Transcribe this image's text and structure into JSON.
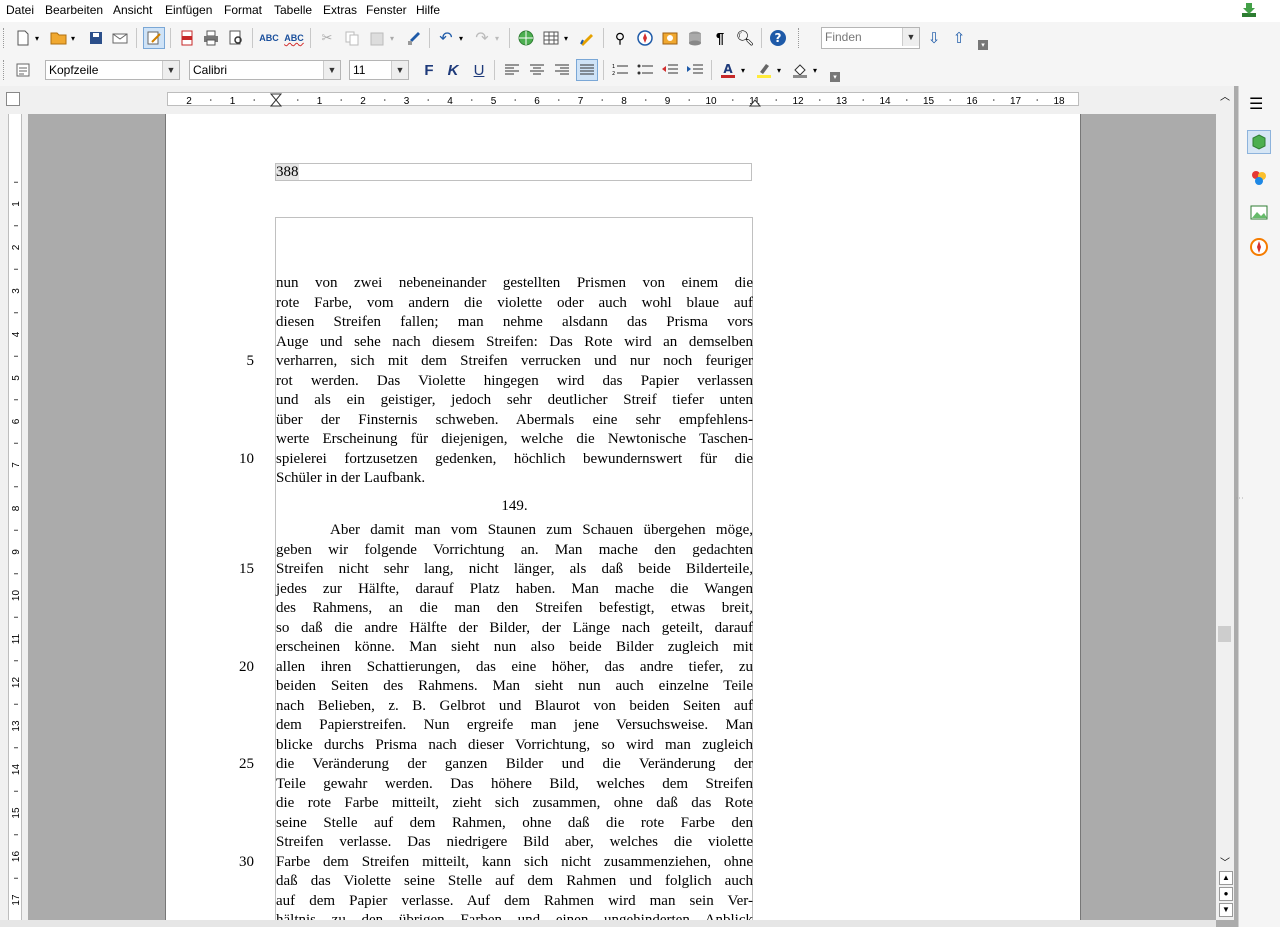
{
  "menu": {
    "items": [
      "Datei",
      "Bearbeiten",
      "Ansicht",
      "Einfügen",
      "Format",
      "Tabelle",
      "Extras",
      "Fenster",
      "Hilfe"
    ]
  },
  "find": {
    "placeholder": "Finden"
  },
  "formatting": {
    "style": "Kopfzeile",
    "font": "Calibri",
    "size": "11",
    "bold": "F",
    "italic": "K",
    "underline": "U"
  },
  "ruler": {
    "h_labels": [
      "2",
      "1",
      "1",
      "2",
      "3",
      "4",
      "5",
      "6",
      "7",
      "8",
      "9",
      "10",
      "11",
      "12",
      "13",
      "14",
      "15",
      "16",
      "17",
      "18"
    ],
    "v_labels": [
      "1",
      "2",
      "3",
      "4",
      "5",
      "6",
      "7",
      "8",
      "9",
      "10",
      "11",
      "12",
      "13",
      "14",
      "15",
      "16",
      "17"
    ]
  },
  "document": {
    "header": "388",
    "lines": [
      {
        "t": "nun von zwei nebeneinander gestellten Prismen von einem die",
        "n": ""
      },
      {
        "t": "rote Farbe, vom andern die violette oder auch wohl blaue auf",
        "n": ""
      },
      {
        "t": "diesen Streifen fallen; man nehme alsdann das Prisma vors",
        "n": ""
      },
      {
        "t": "Auge und sehe nach diesem Streifen: Das Rote wird an demselben",
        "n": ""
      },
      {
        "t": "verharren, sich mit dem Streifen verrucken und nur noch feuriger",
        "n": "5"
      },
      {
        "t": "rot werden. Das Violette hingegen wird das Papier verlassen",
        "n": ""
      },
      {
        "t": "und als ein geistiger, jedoch sehr deutlicher Streif tiefer unten",
        "n": ""
      },
      {
        "t": "über der Finsternis schweben. Abermals eine sehr empfehlens-",
        "n": ""
      },
      {
        "t": "werte Erscheinung für diejenigen, welche die Newtonische Taschen-",
        "n": ""
      },
      {
        "t": "spielerei fortzusetzen gedenken, höchlich bewundernswert für die",
        "n": "10"
      },
      {
        "t": "Schüler in der Laufbank.",
        "n": "",
        "last": true
      },
      {
        "t": "149.",
        "n": "",
        "center": true
      },
      {
        "t": "Aber damit man vom Staunen zum Schauen übergehen möge,",
        "n": "",
        "indent": true
      },
      {
        "t": "geben wir folgende Vorrichtung an. Man mache den gedachten",
        "n": ""
      },
      {
        "t": "Streifen nicht sehr lang, nicht länger, als daß beide Bilderteile,",
        "n": "15"
      },
      {
        "t": "jedes zur Hälfte, darauf Platz haben. Man mache die Wangen",
        "n": ""
      },
      {
        "t": "des Rahmens, an die man den Streifen befestigt, etwas breit,",
        "n": ""
      },
      {
        "t": "so daß die andre Hälfte der Bilder, der Länge nach geteilt, darauf",
        "n": ""
      },
      {
        "t": "erscheinen könne. Man sieht nun also beide Bilder zugleich mit",
        "n": ""
      },
      {
        "t": "allen ihren Schattierungen, das eine höher, das andre tiefer, zu",
        "n": "20"
      },
      {
        "t": "beiden Seiten des Rahmens. Man sieht nun auch einzelne Teile",
        "n": ""
      },
      {
        "t": "nach Belieben, z. B. Gelbrot und Blaurot von beiden Seiten auf",
        "n": ""
      },
      {
        "t": "dem Papierstreifen. Nun ergreife man jene Versuchsweise. Man",
        "n": ""
      },
      {
        "t": "blicke durchs Prisma nach dieser Vorrichtung, so wird man zugleich",
        "n": ""
      },
      {
        "t": "die Veränderung der ganzen Bilder und die Veränderung der",
        "n": "25"
      },
      {
        "t": "Teile gewahr werden. Das höhere Bild, welches dem Streifen",
        "n": ""
      },
      {
        "t": "die rote Farbe mitteilt, zieht sich zusammen, ohne daß das Rote",
        "n": ""
      },
      {
        "t": "seine Stelle auf dem Rahmen, ohne daß die rote Farbe den",
        "n": ""
      },
      {
        "t": "Streifen verlasse. Das niedrigere Bild aber, welches die violette",
        "n": ""
      },
      {
        "t": "Farbe dem Streifen mitteilt, kann sich nicht zusammenziehen, ohne",
        "n": "30"
      },
      {
        "t": "daß das Violette seine Stelle auf dem Rahmen und folglich auch",
        "n": ""
      },
      {
        "t": "auf dem Papier verlasse. Auf dem Rahmen wird man sein Ver-",
        "n": ""
      },
      {
        "t": "hältnis zu den übrigen Farben und einen ungehinderten Anblick",
        "n": ""
      }
    ]
  }
}
